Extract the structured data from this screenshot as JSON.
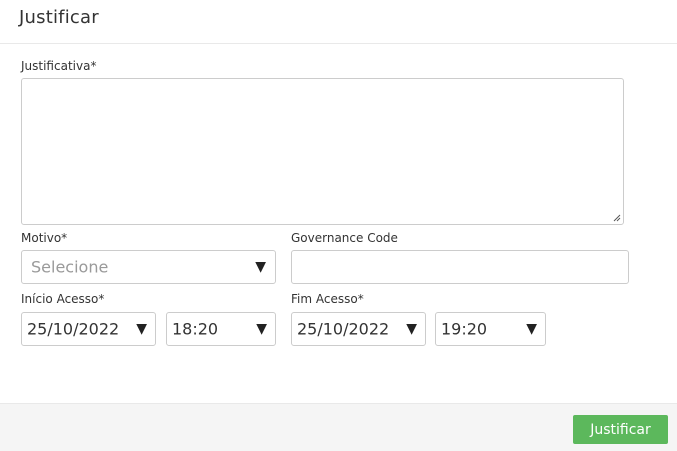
{
  "modal": {
    "title": "Justificar"
  },
  "form": {
    "justificativa": {
      "label": "Justificativa*",
      "value": ""
    },
    "motivo": {
      "label": "Motivo*",
      "placeholder": "Selecione"
    },
    "governance_code": {
      "label": "Governance Code",
      "value": ""
    },
    "inicio_acesso": {
      "label": "Início Acesso*",
      "date": "25/10/2022",
      "time": "18:20"
    },
    "fim_acesso": {
      "label": "Fim Acesso*",
      "date": "25/10/2022",
      "time": "19:20"
    }
  },
  "footer": {
    "submit_label": "Justificar"
  },
  "icons": {
    "caret": "▼"
  },
  "colors": {
    "primary_button": "#5cb85c",
    "border": "#cccccc",
    "footer_bg": "#f5f5f5",
    "placeholder": "#9a9a9a"
  }
}
